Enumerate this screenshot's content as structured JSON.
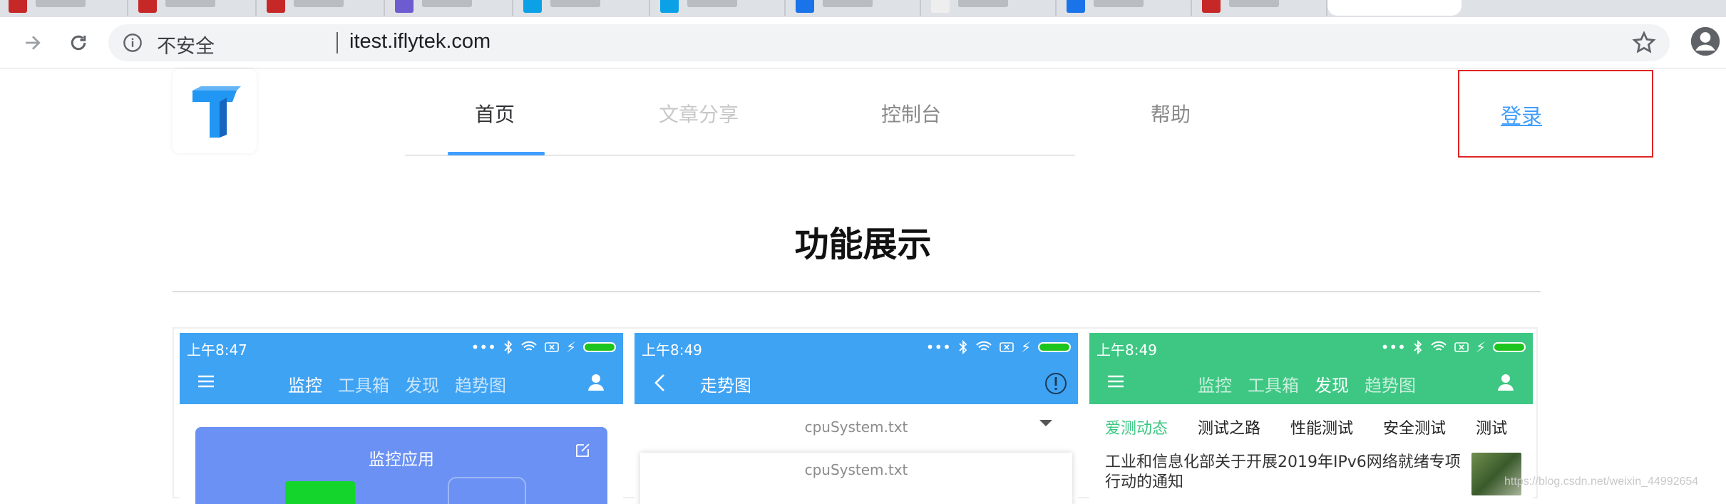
{
  "browser": {
    "tab_colors": [
      "#c62828",
      "#c62828",
      "#c62828",
      "#6d5bd0",
      "#0aa1e6",
      "#0aa1e6",
      "#1a73e8",
      "#eeeeee",
      "#1a73e8",
      "#c62828"
    ],
    "security_label": "不安全",
    "url": "itest.iflytek.com"
  },
  "nav": {
    "items": [
      {
        "label": "首页",
        "active": true
      },
      {
        "label": "文章分享",
        "active": false
      },
      {
        "label": "控制台",
        "active": false
      },
      {
        "label": "帮助",
        "active": false
      }
    ],
    "login": "登录"
  },
  "section": {
    "title": "功能展示"
  },
  "phones": [
    {
      "time": "上午8:47",
      "tabs": [
        "监控",
        "工具箱",
        "发现",
        "趋势图"
      ],
      "active_tab": 0,
      "card_title": "监控应用"
    },
    {
      "time": "上午8:49",
      "title": "走势图",
      "dropdown": "cpuSystem.txt",
      "file": "cpuSystem.txt"
    },
    {
      "time": "上午8:49",
      "tabs": [
        "监控",
        "工具箱",
        "发现",
        "趋势图"
      ],
      "active_tab": 2,
      "subnav": [
        "爱测动态",
        "测试之路",
        "性能测试",
        "安全测试",
        "测试"
      ],
      "news_title": "工业和信息化部关于开展2019年IPv6网络就绪专项行动的通知"
    }
  ],
  "colors": {
    "accent": "#409eff",
    "phone_blue": "#3fa3f4",
    "phone_green": "#3dc783",
    "login_highlight": "#e02424"
  },
  "watermark": "https://blog.csdn.net/weixin_44992654"
}
